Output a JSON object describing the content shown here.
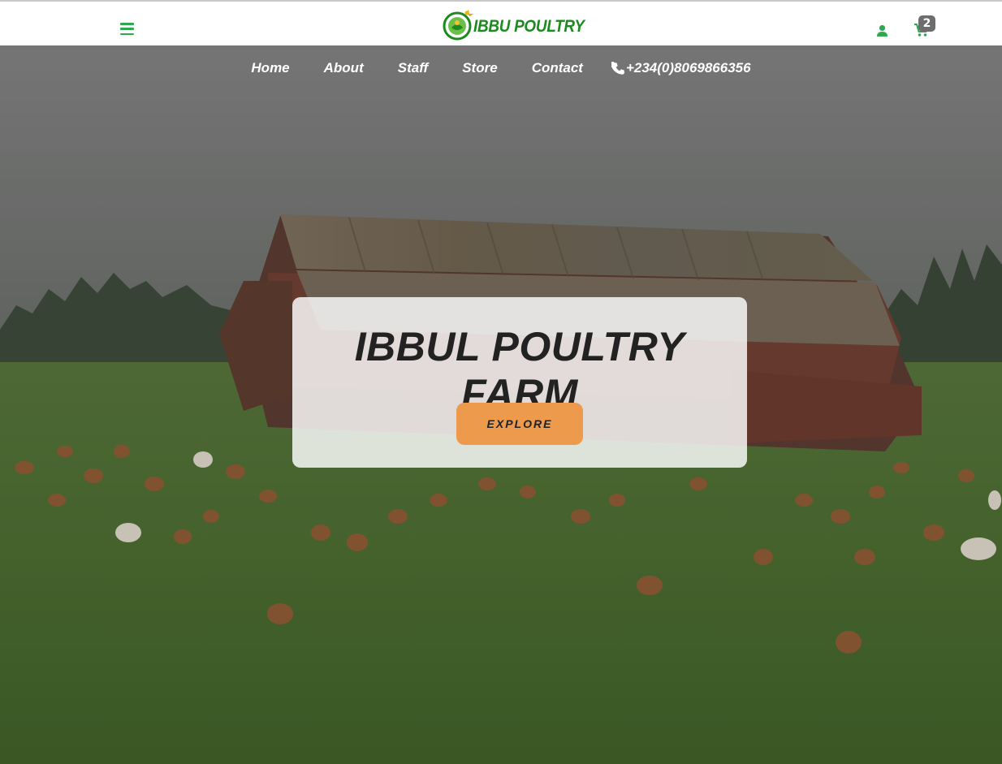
{
  "header": {
    "logo_text": "IBBU POULTRY",
    "cart_count": "2",
    "brand_color": "#1d8a1f",
    "accent_green": "#2fa84f"
  },
  "nav": {
    "items": [
      {
        "label": "Home"
      },
      {
        "label": "About"
      },
      {
        "label": "Staff"
      },
      {
        "label": "Store"
      },
      {
        "label": "Contact"
      }
    ],
    "phone": "+234(0)8069866356"
  },
  "hero": {
    "title": "IBBUL POULTRY FARM",
    "button_label": "EXPLORE",
    "button_color": "#ee9a4d"
  },
  "icons": {
    "menu": "hamburger-menu-icon",
    "user": "user-icon",
    "cart": "cart-icon",
    "phone": "phone-icon"
  }
}
